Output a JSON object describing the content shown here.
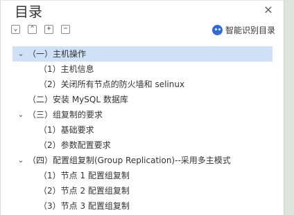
{
  "title": "目录",
  "toolbar": {
    "buttons": [
      "⌄",
      "⌃",
      "+",
      "−"
    ]
  },
  "ai_button": {
    "label": "智能识别目录"
  },
  "toc": [
    {
      "level": 1,
      "label": "（一）主机操作",
      "expanded": true,
      "selected": true
    },
    {
      "level": 2,
      "label": "（1）主机信息"
    },
    {
      "level": 2,
      "label": "（2）关闭所有节点的防火墙和 selinux"
    },
    {
      "level": 1,
      "label": "（二）安装 MySQL 数据库"
    },
    {
      "level": 1,
      "label": "（三）组复制的要求",
      "expanded": true
    },
    {
      "level": 2,
      "label": "（1）基础要求"
    },
    {
      "level": 2,
      "label": "（2）参数配置要求"
    },
    {
      "level": 1,
      "label": "（四）配置组复制(Group Replication)--采用多主模式",
      "expanded": true
    },
    {
      "level": 2,
      "label": "（1）节点 1 配置组复制"
    },
    {
      "level": 2,
      "label": "（2）节点 2 配置组复制"
    },
    {
      "level": 2,
      "label": "（3）节点 3 配置组复制"
    }
  ]
}
